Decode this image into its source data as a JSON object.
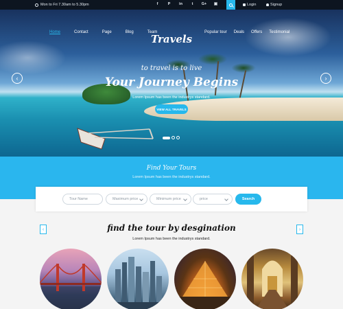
{
  "topbar": {
    "hours": "Mon to Fri 7.30am to 5.30pm",
    "social_icons": [
      "facebook-icon",
      "pinterest-icon",
      "linkedin-icon",
      "tumblr-icon",
      "google-plus-icon",
      "instagram-icon"
    ],
    "social_glyphs": [
      "f",
      "P",
      "in",
      "t",
      "G+",
      "▣"
    ],
    "login": "Login",
    "signup": "Signup"
  },
  "nav": {
    "left": [
      "Home",
      "Contact",
      "Page",
      "Blog",
      "Team"
    ],
    "right": [
      "Popular tour",
      "Deals",
      "Offers",
      "Testimonial"
    ],
    "logo": "Travels"
  },
  "hero": {
    "tagline": "to travel is to live",
    "headline": "Your Journey Begins",
    "description": "Lorem Ipsum has been the industrys standard.",
    "button": "VIEW ALL TRAVELS"
  },
  "find": {
    "title": "Find Your Tours",
    "subtitle": "Lorem Ipsum has been the industrys standard.",
    "tour_name_placeholder": "Tour Name",
    "max_price": "Maximum price",
    "min_price": "Minimum price",
    "price": "price",
    "search": "Search"
  },
  "destinations": {
    "title": "find the tour by desgination",
    "subtitle": "Lorem Ipsum has been the industrys standard.",
    "prev": "‹",
    "next": "›"
  },
  "colors": {
    "accent": "#27b8ec",
    "topbar": "#0d1520",
    "band": "#2ab6ee"
  }
}
